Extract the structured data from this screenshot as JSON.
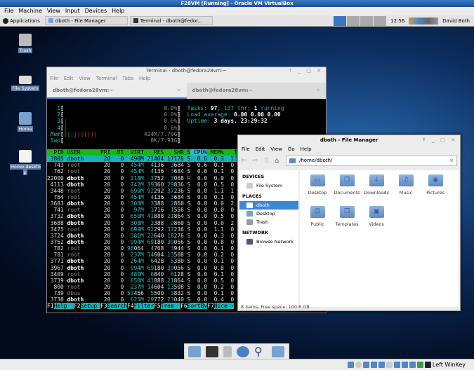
{
  "vbox": {
    "title": "F28VM [Running] - Oracle VM VirtualBox",
    "menu": [
      "File",
      "Machine",
      "View",
      "Input",
      "Devices",
      "Help"
    ],
    "status_key": "Left WinKey"
  },
  "panel": {
    "applications": "Applications",
    "tasks": [
      "dboth - File Manager",
      "Terminal - dboth@fedor..."
    ],
    "clock": "12:56",
    "user": "David Both"
  },
  "desktop_icons": [
    "Trash",
    "File System",
    "Home",
    "Home.deskto p"
  ],
  "terminal": {
    "title": "Terminal - dboth@fedora28vm:~",
    "menu": [
      "File",
      "Edit",
      "View",
      "Terminal",
      "Tabs",
      "Help"
    ],
    "tabs": [
      "dboth@fedora28vm:~",
      "dboth@fedora28vm:~"
    ],
    "htop": {
      "cpus": [
        {
          "n": "1",
          "v": "0.0%"
        },
        {
          "n": "2",
          "v": "0.0%"
        },
        {
          "n": "3",
          "v": "0.6%"
        },
        {
          "n": "4",
          "v": "0.6%"
        }
      ],
      "mem": "424M/7.79G",
      "swp": "0K/7.91G",
      "tasks": "97",
      "thr": "137",
      "running": "1",
      "load": "0.00 0.00 0.00",
      "uptime": "3 days, 23:29:32",
      "labels": {
        "tasks": "Tasks: ",
        "thr": " thr; ",
        "running": " running",
        "load": "Load average: ",
        "uptime": "Uptime: ",
        "mem": "Mem",
        "swp": "Swp"
      },
      "columns": [
        "PID",
        "USER",
        "PRI",
        "NI",
        "VIRT",
        "RES",
        "SHR",
        "S",
        "CPU%",
        "MEM%"
      ],
      "rows": [
        [
          "3805",
          "dboth",
          "20",
          "0",
          "498M",
          "21404",
          "17176",
          "S",
          "0.6",
          "0.3",
          "1"
        ],
        [
          "743",
          "root",
          "20",
          "0",
          "454M",
          "4136",
          "3684",
          "S",
          "0.6",
          "0.1",
          "0"
        ],
        [
          "762",
          "root",
          "20",
          "0",
          "454M",
          "4136",
          "3684",
          "S",
          "0.6",
          "0.1",
          "0"
        ],
        [
          "22000",
          "dboth",
          "20",
          "0",
          "218M",
          "3752",
          "3068",
          "R",
          "0.0",
          "0.0",
          "0"
        ],
        [
          "4113",
          "dboth",
          "20",
          "0",
          "742M",
          "39360",
          "29836",
          "S",
          "0.0",
          "0.5",
          "0"
        ],
        [
          "3448",
          "root",
          "20",
          "0",
          "699M",
          "92292",
          "37236",
          "S",
          "0.0",
          "1.1",
          "1"
        ],
        [
          "764",
          "root",
          "20",
          "0",
          "454M",
          "4136",
          "3684",
          "S",
          "0.0",
          "0.1",
          "0"
        ],
        [
          "3683",
          "dboth",
          "20",
          "0",
          "308M",
          "3388",
          "2860",
          "S",
          "0.0",
          "0.0",
          "2"
        ],
        [
          "741",
          "root",
          "20",
          "0",
          "97M",
          "1716",
          "1556",
          "S",
          "0.0",
          "0.0",
          "0"
        ],
        [
          "3732",
          "dboth",
          "20",
          "0",
          "650M",
          "41888",
          "21864",
          "S",
          "0.0",
          "0.5",
          "0"
        ],
        [
          "3688",
          "dboth",
          "20",
          "0",
          "308M",
          "3388",
          "2860",
          "S",
          "0.0",
          "0.0",
          "2"
        ],
        [
          "3475",
          "root",
          "20",
          "0",
          "699M",
          "92292",
          "37236",
          "S",
          "0.0",
          "1.1",
          "0"
        ],
        [
          "3724",
          "dboth",
          "20",
          "0",
          "381M",
          "22640",
          "18276",
          "S",
          "0.0",
          "0.3",
          "0"
        ],
        [
          "3752",
          "dboth",
          "20",
          "0",
          "994M",
          "69180",
          "39056",
          "S",
          "0.0",
          "0.8",
          "0"
        ],
        [
          "782",
          "root",
          "20",
          "0",
          "98064",
          "4768",
          "3944",
          "S",
          "0.0",
          "0.1",
          "0"
        ],
        [
          "781",
          "root",
          "20",
          "0",
          "237M",
          "14604",
          "13508",
          "S",
          "0.0",
          "0.2",
          "0"
        ],
        [
          "3771",
          "dboth",
          "20",
          "0",
          "264M",
          "6428",
          "5380",
          "S",
          "0.0",
          "0.1",
          "0"
        ],
        [
          "3967",
          "dboth",
          "20",
          "0",
          "994M",
          "69180",
          "39056",
          "S",
          "0.0",
          "0.8",
          "0"
        ],
        [
          "3409",
          "root",
          "20",
          "0",
          "480M",
          "6840",
          "6128",
          "S",
          "0.0",
          "0.1",
          "0"
        ],
        [
          "3739",
          "dboth",
          "20",
          "0",
          "650M",
          "41888",
          "21864",
          "S",
          "0.0",
          "0.5",
          "0"
        ],
        [
          "800",
          "root",
          "20",
          "0",
          "237M",
          "14604",
          "13508",
          "S",
          "0.0",
          "0.2",
          "0"
        ],
        [
          "739",
          "dbus",
          "20",
          "0",
          "53456",
          "5500",
          "3832",
          "S",
          "0.0",
          "0.1",
          "0"
        ],
        [
          "3730",
          "dboth",
          "20",
          "0",
          "625M",
          "29772",
          "23040",
          "S",
          "0.0",
          "0.4",
          "0"
        ]
      ],
      "footer": [
        [
          "F1",
          "Help  "
        ],
        [
          "F2",
          "Setup "
        ],
        [
          "F3",
          "Search"
        ],
        [
          "F4",
          "Filter"
        ],
        [
          "F5",
          "Tree  "
        ],
        [
          "F6",
          "SortBy"
        ],
        [
          "F7",
          "Nice -"
        ]
      ]
    }
  },
  "file_manager": {
    "title": "dboth - File Manager",
    "menu": [
      "File",
      "Edit",
      "View",
      "Go",
      "Help"
    ],
    "path": "/home/dboth/",
    "sidebar": {
      "devices_header": "DEVICES",
      "devices": [
        "File System"
      ],
      "places_header": "PLACES",
      "places": [
        "dboth",
        "Desktop",
        "Trash"
      ],
      "network_header": "NETWORK",
      "network": [
        "Browse Network"
      ]
    },
    "items": [
      "Desktop",
      "Documents",
      "Downloads",
      "Music",
      "Pictures",
      "Public",
      "Templates",
      "Videos"
    ],
    "status": "8 items, Free space: 100.6 GB"
  },
  "colors": {
    "accent": "#3d86d6",
    "htop_green": "#18b818",
    "htop_cyan": "#19b2b8"
  }
}
